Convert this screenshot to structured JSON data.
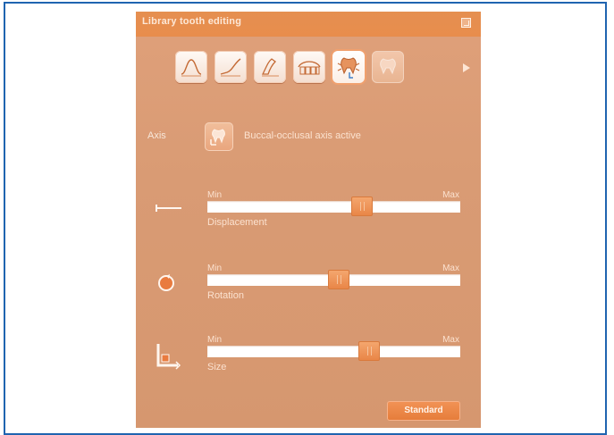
{
  "window": {
    "title": "Library tooth editing"
  },
  "toolbar": {
    "tools": [
      {
        "icon": "gauss-curve-icon"
      },
      {
        "icon": "ramp-curve-icon"
      },
      {
        "icon": "pen-curve-icon"
      },
      {
        "icon": "teeth-row-icon"
      },
      {
        "icon": "tooth-selection-icon",
        "active": true
      },
      {
        "icon": "tooth-faded-icon"
      }
    ],
    "next_icon": "chevron-right-icon"
  },
  "axis": {
    "label": "Axis",
    "icon": "axis-tooth-icon",
    "value": "Buccal-occlusal axis active"
  },
  "sliders": [
    {
      "icon": "displacement-icon",
      "min_label": "Min",
      "max_label": "Max",
      "name": "Displacement",
      "value_fraction": 0.61
    },
    {
      "icon": "rotation-icon",
      "min_label": "Min",
      "max_label": "Max",
      "name": "Rotation",
      "value_fraction": 0.52
    },
    {
      "icon": "size-icon",
      "min_label": "Min",
      "max_label": "Max",
      "name": "Size",
      "value_fraction": 0.64
    }
  ],
  "standard_button": {
    "label": "Standard"
  },
  "colors": {
    "frame": "#1f64b0",
    "panel": "#d99b74",
    "accent": "#e8874a"
  }
}
